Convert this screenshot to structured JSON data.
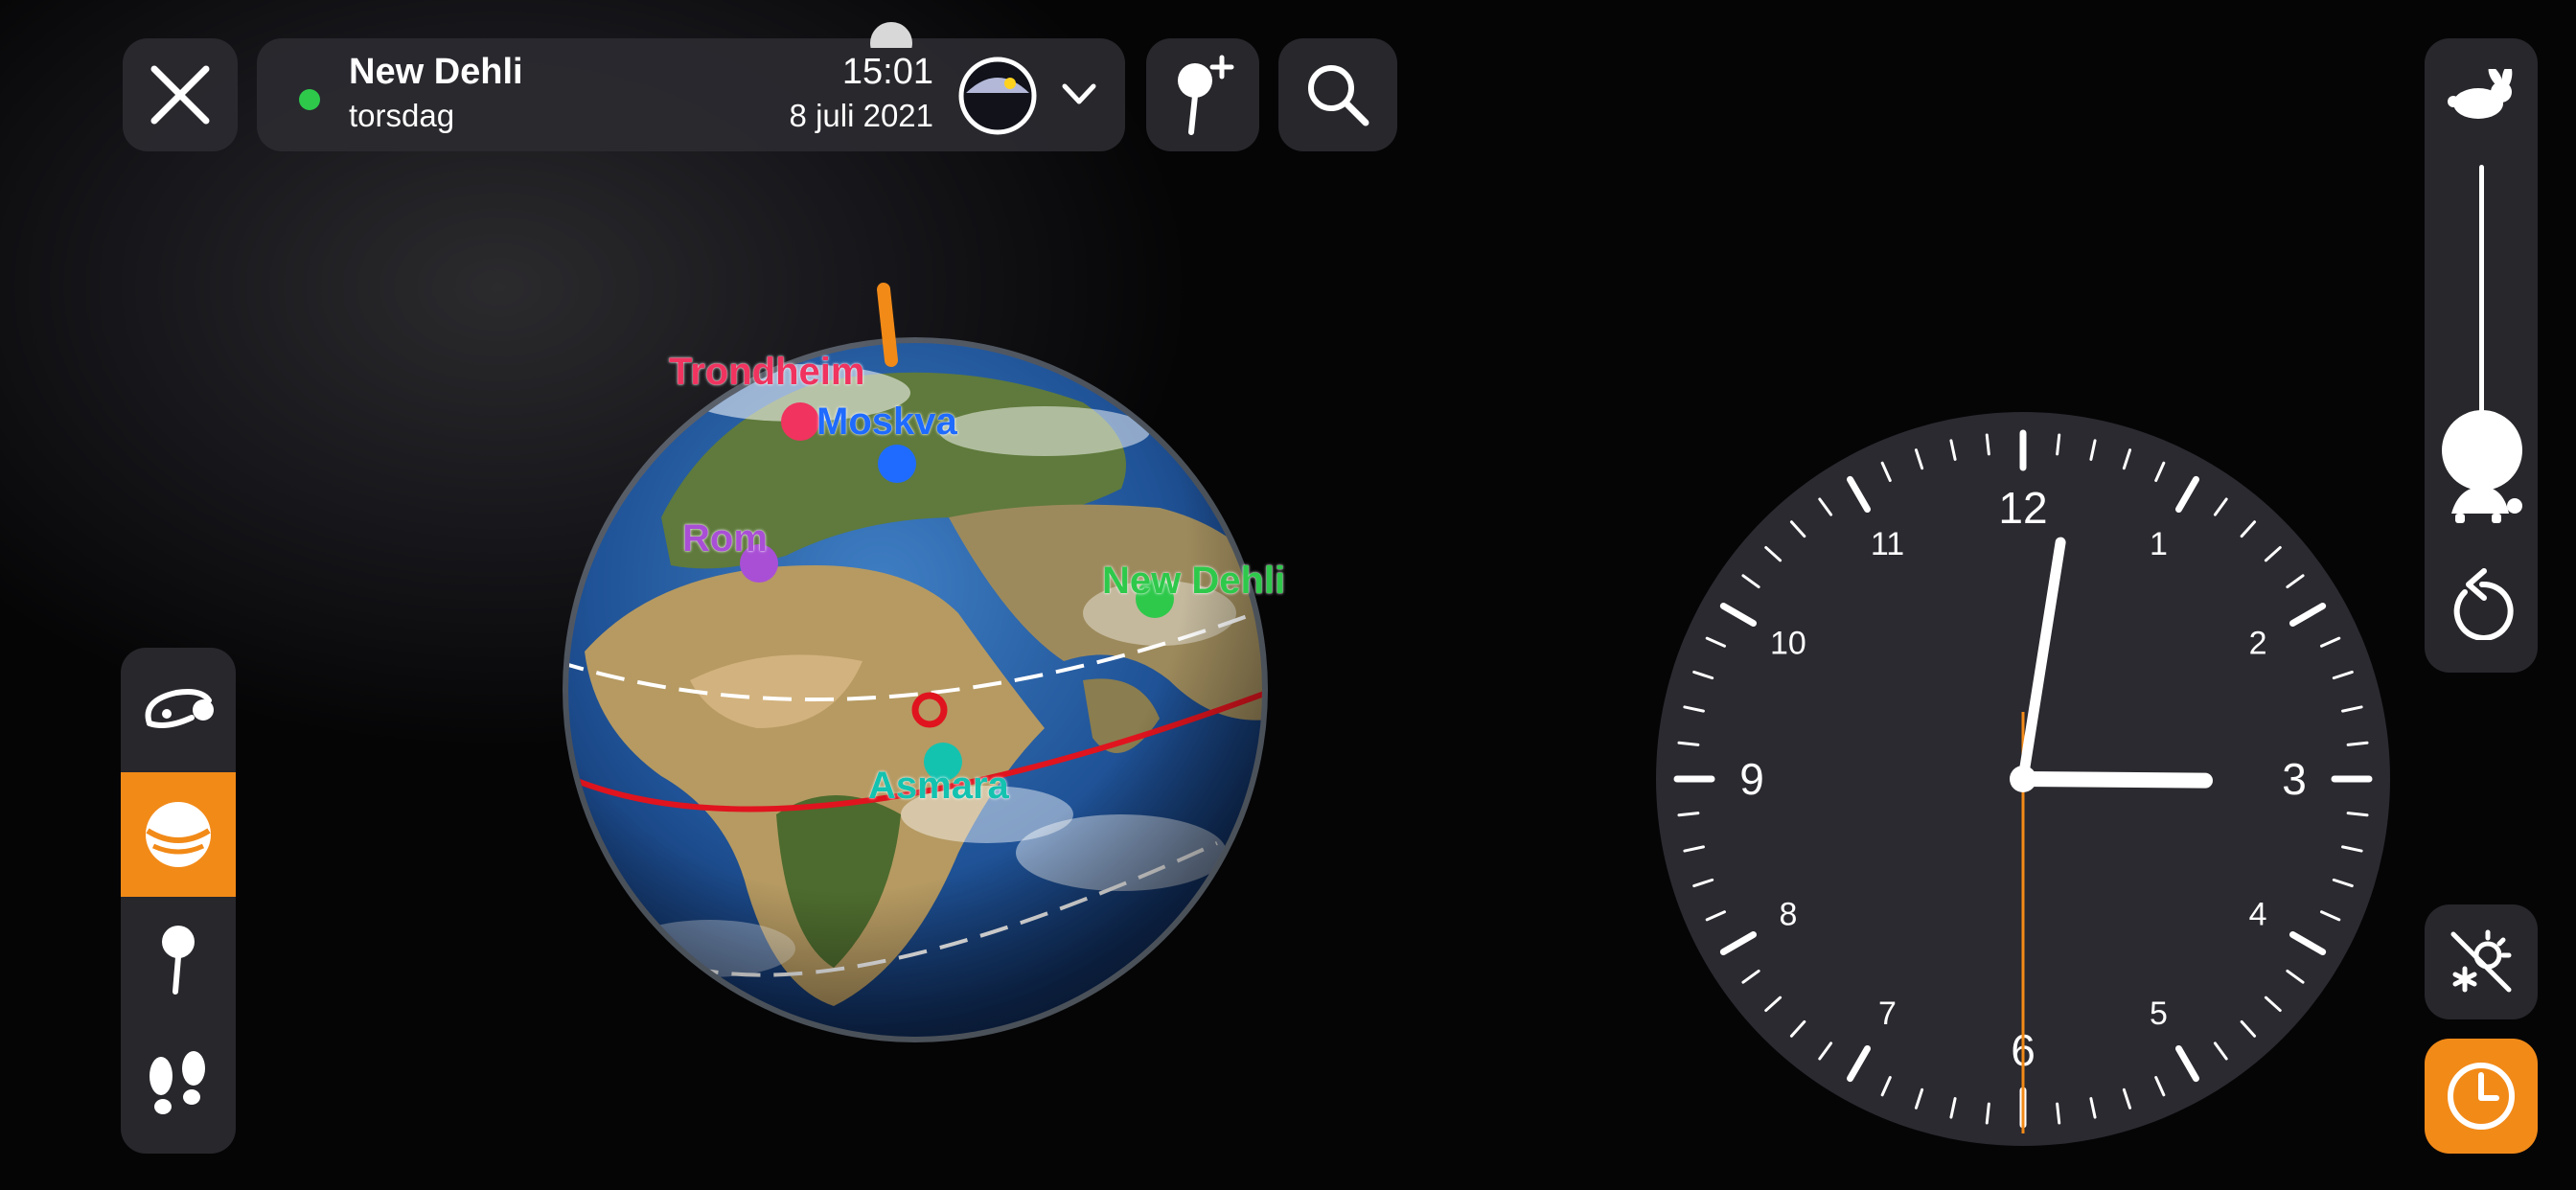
{
  "header": {
    "location_name": "New Dehli",
    "weekday": "torsdag",
    "time": "15:01",
    "date": "8 juli 2021",
    "status_color": "#2ec94b"
  },
  "toolbar_icons": {
    "close": "close-icon",
    "expand": "chevron-down-icon",
    "add_pin": "add-pin-icon",
    "search": "search-icon",
    "daylight": "day-night-icon"
  },
  "globe": {
    "markers": [
      {
        "name": "Trondheim",
        "color": "#f0335f"
      },
      {
        "name": "Moskva",
        "color": "#1f6bff"
      },
      {
        "name": "Rom",
        "color": "#a94fd6"
      },
      {
        "name": "New Dehli",
        "color": "#2ec94b"
      },
      {
        "name": "Asmara",
        "color": "#14c2b0"
      }
    ]
  },
  "left_toolbar": {
    "items": [
      {
        "icon": "orbit-icon",
        "active": false
      },
      {
        "icon": "planet-icon",
        "active": true
      },
      {
        "icon": "pin-icon",
        "active": false
      },
      {
        "icon": "footsteps-icon",
        "active": false
      }
    ]
  },
  "speed_control": {
    "fast_icon": "rabbit-icon",
    "slow_icon": "turtle-icon",
    "reset_icon": "reset-icon",
    "level": 0.0
  },
  "clock": {
    "numbers": [
      "12",
      "1",
      "2",
      "3",
      "4",
      "5",
      "6",
      "7",
      "8",
      "9",
      "10",
      "11"
    ],
    "hours": 15,
    "minutes": 1,
    "seconds": 30
  },
  "bottom_right": {
    "weather_icon": "weather-off-icon",
    "clock_icon": "clock-icon"
  },
  "colors": {
    "accent": "#f28a18",
    "panel": "#2a2a30",
    "equator": "#e0141e"
  }
}
